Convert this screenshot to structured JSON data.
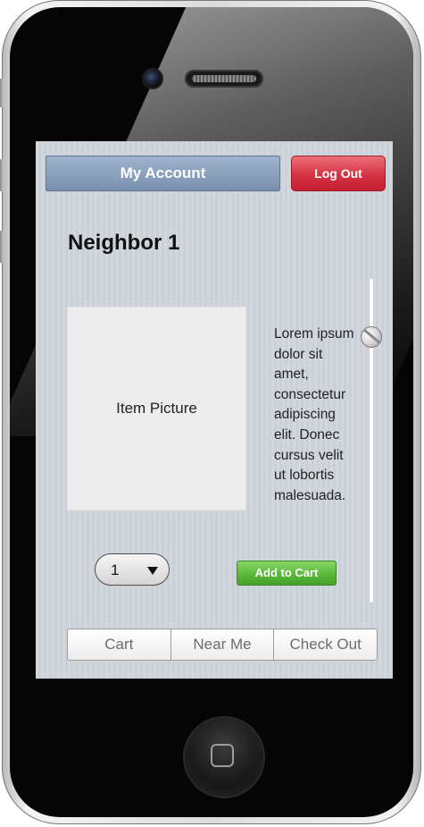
{
  "header": {
    "account_label": "My Account",
    "logout_label": "Log Out"
  },
  "neighbor": {
    "title": "Neighbor 1"
  },
  "item": {
    "picture_label": "Item Picture",
    "description": "Lorem ipsum dolor sit amet, consectetur adipiscing elit. Donec cursus velit ut lobortis malesuada.",
    "quantity": "1",
    "add_to_cart_label": "Add to Cart"
  },
  "tabs": [
    {
      "label": "Cart"
    },
    {
      "label": "Near Me"
    },
    {
      "label": "Check Out"
    }
  ],
  "scroll": {
    "position": 0.16
  },
  "colors": {
    "account_button": "#7f97b4",
    "logout_button": "#d32f42",
    "add_to_cart_button": "#55b336",
    "screen_background": "#d0d4db"
  }
}
